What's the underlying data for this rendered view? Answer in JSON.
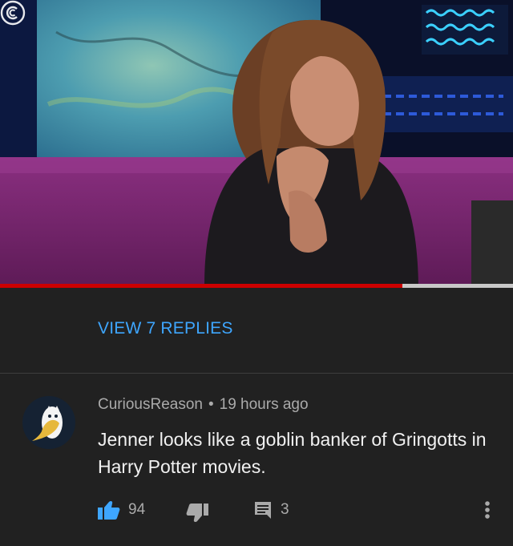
{
  "video": {
    "channel_logo": "comedy-central-logo",
    "progress_fraction": 0.785
  },
  "replies": {
    "label": "VIEW 7 REPLIES"
  },
  "comment": {
    "author": "CuriousReason",
    "separator": "•",
    "time": "19 hours ago",
    "text": "Jenner looks like a goblin banker of Gringotts in Harry Potter movies.",
    "like_count": "94",
    "reply_count": "3",
    "avatar_icon": "owl-icon"
  },
  "colors": {
    "accent": "#3ea6ff",
    "background": "#212121",
    "progress": "#cc0000"
  }
}
